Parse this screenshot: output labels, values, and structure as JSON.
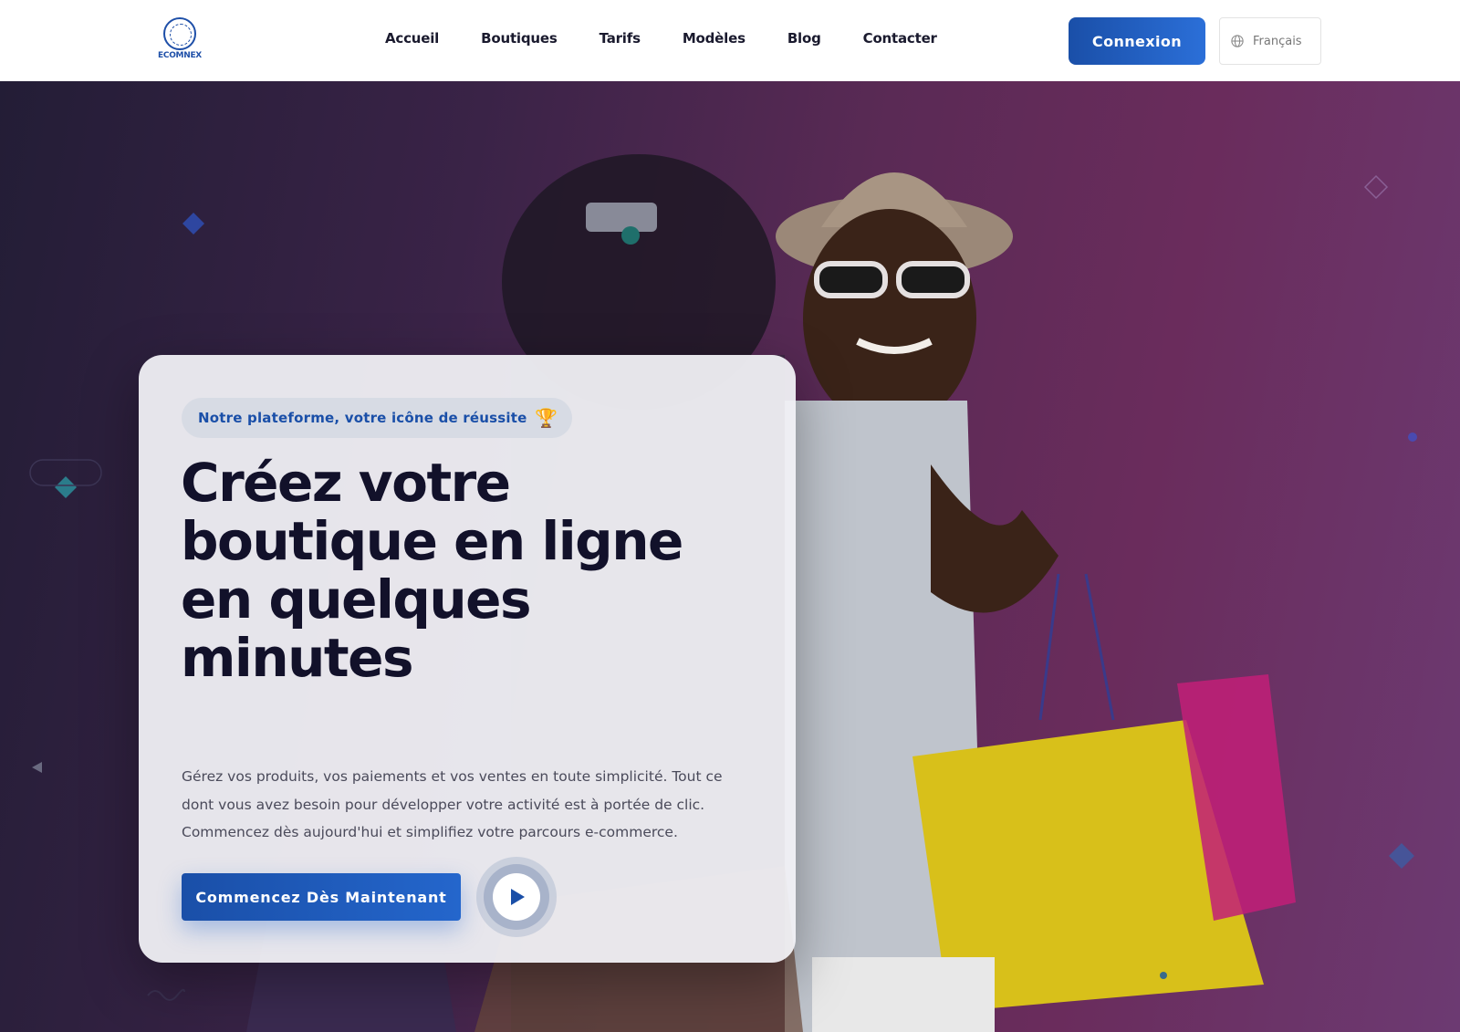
{
  "header": {
    "logo_text": "ECOMNEX",
    "nav": [
      "Accueil",
      "Boutiques",
      "Tarifs",
      "Modèles",
      "Blog",
      "Contacter"
    ],
    "login_label": "Connexion",
    "language": "Français"
  },
  "hero": {
    "badge": "Notre plateforme, votre icône de réussite",
    "badge_icon": "🏆",
    "headline": "Créez votre boutique en ligne en quelques minutes",
    "description": "Gérez vos produits, vos paiements et vos ventes en toute simplicité. Tout ce dont vous avez besoin pour développer votre activité est à portée de clic. Commencez dès aujourd'hui et simplifiez votre parcours e-commerce.",
    "cta_label": "Commencez Dès Maintenant"
  },
  "colors": {
    "brand": "#1a4fa8",
    "heading": "#12112a"
  }
}
